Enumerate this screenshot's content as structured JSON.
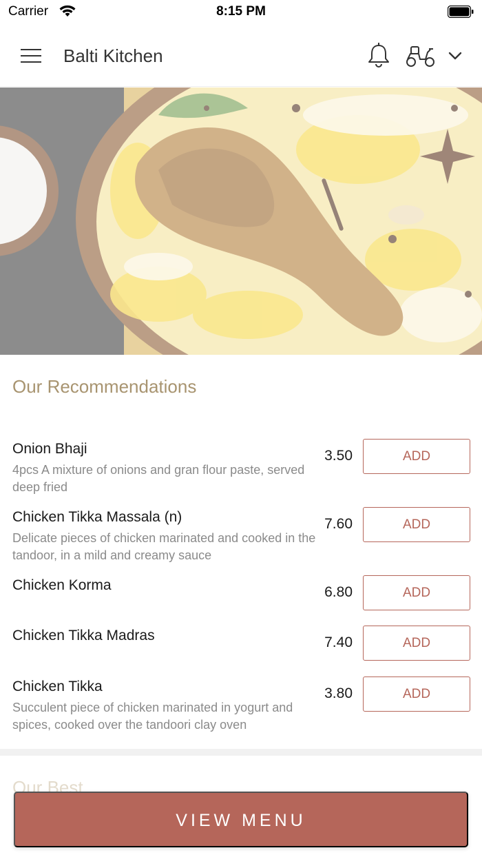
{
  "status_bar": {
    "carrier": "Carrier",
    "time": "8:15 PM"
  },
  "header": {
    "title": "Balti Kitchen",
    "icons": [
      "menu-icon",
      "bell-icon",
      "scooter-icon",
      "chevron-down-icon"
    ]
  },
  "hero": {
    "image": "biryani-dish-photo"
  },
  "recommendations": {
    "title": "Our Recommendations",
    "items": [
      {
        "name": "Onion Bhaji",
        "description": "4pcs A mixture of onions and gran flour paste, served deep fried",
        "price": "3.50",
        "add_label": "ADD"
      },
      {
        "name": "Chicken Tikka Massala (n)",
        "description": "Delicate pieces of chicken marinated and cooked in the tandoor, in a mild and creamy sauce",
        "price": "7.60",
        "add_label": "ADD"
      },
      {
        "name": "Chicken Korma",
        "description": "",
        "price": "6.80",
        "add_label": "ADD"
      },
      {
        "name": "Chicken Tikka Madras",
        "description": "",
        "price": "7.40",
        "add_label": "ADD"
      },
      {
        "name": "Chicken Tikka",
        "description": "Succulent piece of chicken marinated in yogurt and spices, cooked over the tandoori clay oven",
        "price": "3.80",
        "add_label": "ADD"
      }
    ]
  },
  "next_section_title": "Our Best",
  "view_menu_label": "VIEW MENU",
  "colors": {
    "accent": "#b5665a",
    "section_title": "#a89470"
  }
}
